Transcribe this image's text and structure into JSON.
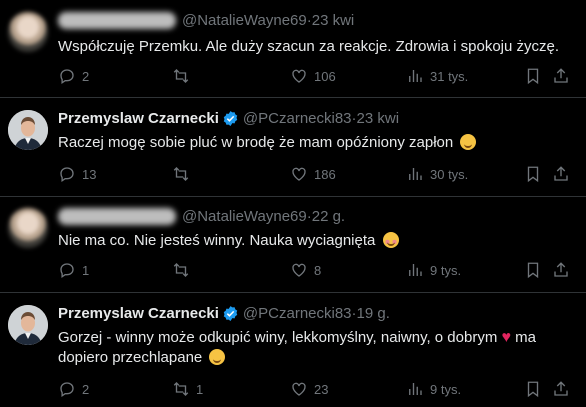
{
  "tweets": [
    {
      "author": {
        "name": "",
        "handle": "@NatalieWayne69",
        "time": "23 kwi",
        "verified": false,
        "name_blurred": true
      },
      "text": "Współczuję Przemku. Ale duży szacun za reakcje. Zdrowia i spokoju życzę.",
      "replies": "2",
      "retweets": "",
      "likes": "106",
      "views": "31 tys."
    },
    {
      "author": {
        "name": "Przemyslaw Czarnecki",
        "handle": "@PCzarnecki83",
        "time": "23 kwi",
        "verified": true
      },
      "text": "Raczej mogę sobie pluć w brodę że mam opóźniony zapłon",
      "replies": "13",
      "retweets": "",
      "likes": "186",
      "views": "30 tys."
    },
    {
      "author": {
        "name": "",
        "handle": "@NatalieWayne69",
        "time": "22 g.",
        "verified": false,
        "name_blurred": true
      },
      "text": "Nie ma co. Nie jesteś winny. Nauka wyciagnięta",
      "replies": "1",
      "retweets": "",
      "likes": "8",
      "views": "9 tys."
    },
    {
      "author": {
        "name": "Przemyslaw Czarnecki",
        "handle": "@PCzarnecki83",
        "time": "19 g.",
        "verified": true
      },
      "text_before_heart": "Gorzej - winny może odkupić winy, lekkomyślny, naiwny, o dobrym",
      "text_after_heart": "ma dopiero przechlapane",
      "replies": "2",
      "retweets": "1",
      "likes": "23",
      "views": "9 tys."
    }
  ],
  "sep": " · ",
  "colors": {
    "background": "#000000",
    "text": "#e7e9ea",
    "muted": "#71767b",
    "verified": "#1d9bf0",
    "heart": "#e0245e"
  }
}
